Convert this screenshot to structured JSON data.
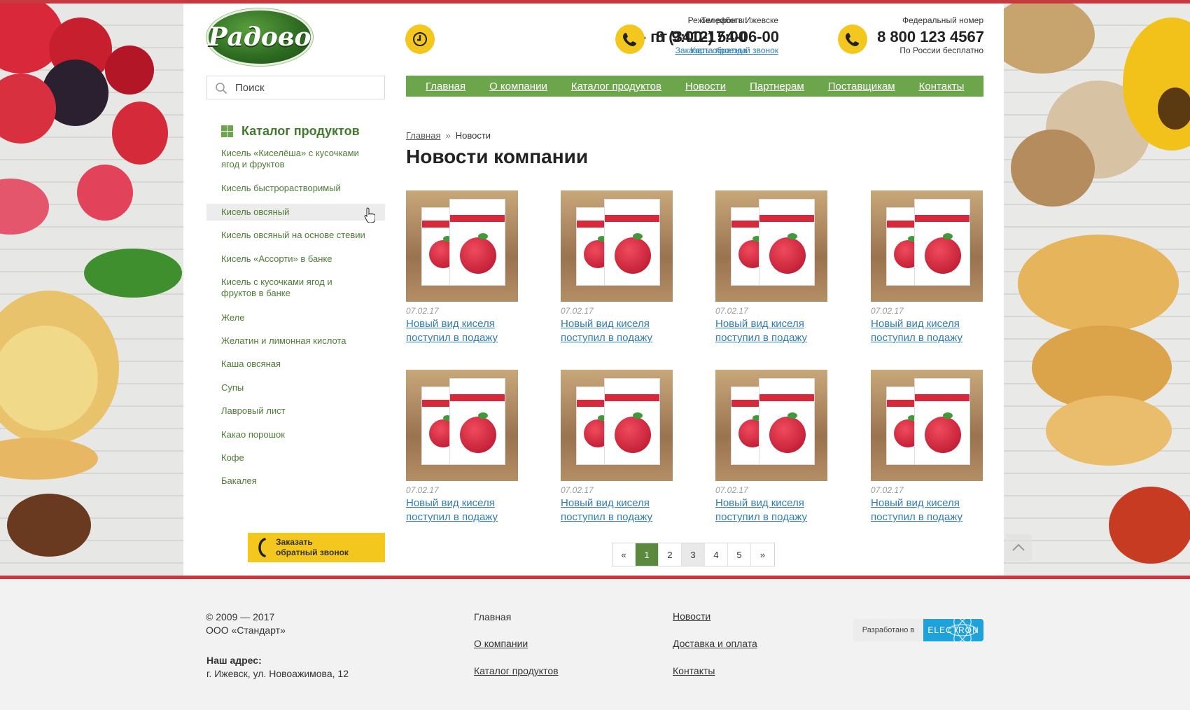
{
  "colors": {
    "accent_red": "#c9373f",
    "nav_green": "#6ca54b",
    "link_blue": "#2e7db6",
    "yellow": "#f4c71e"
  },
  "header": {
    "logo_text": "Радово",
    "hours": {
      "label": "Режим работы:",
      "value": "пн- пт 9:00-17:00",
      "link": "Карта проезда",
      "icon": "clock-icon"
    },
    "phone_local": {
      "label": "Телефон в Ижевске",
      "value": "8 (3412) 54-06-00",
      "link": "Заказать обратный звонок",
      "icon": "phone-icon"
    },
    "phone_federal": {
      "label": "Федеральный номер",
      "value": "8 800 123 4567",
      "sub": "По России бесплатно",
      "icon": "phone-icon"
    }
  },
  "search": {
    "placeholder": "Поиск"
  },
  "nav": [
    "Главная",
    "О компании",
    "Каталог продуктов",
    "Новости",
    "Партнерам",
    "Поставщикам",
    "Контакты"
  ],
  "sidebar": {
    "title": "Каталог продуктов",
    "items": [
      "Кисель «Киселёша» с кусочками ягод и фруктов",
      "Кисель быстрорастворимый",
      "Кисель овсяный",
      "Кисель овсяный на основе стевии",
      "Кисель «Ассорти» в банке",
      "Кисель с кусочками ягод и фруктов в банке",
      "Желе",
      "Желатин и лимонная кислота",
      "Каша овсяная",
      "Супы",
      "Лавровый лист",
      "Какао порошок",
      "Кофе",
      "Бакалея"
    ],
    "active_index": 2,
    "callback_line1": "Заказать",
    "callback_line2": "обратный звонок"
  },
  "breadcrumb": {
    "home": "Главная",
    "separator": "»",
    "current": "Новости"
  },
  "page_title": "Новости компании",
  "news": [
    {
      "date": "07.02.17",
      "title": "Новый вид киселя поступил в подажу"
    },
    {
      "date": "07.02.17",
      "title": "Новый вид киселя поступил в подажу"
    },
    {
      "date": "07.02.17",
      "title": "Новый вид киселя поступил в подажу"
    },
    {
      "date": "07.02.17",
      "title": "Новый вид киселя поступил в подажу"
    },
    {
      "date": "07.02.17",
      "title": "Новый вид киселя поступил в подажу"
    },
    {
      "date": "07.02.17",
      "title": "Новый вид киселя поступил в подажу"
    },
    {
      "date": "07.02.17",
      "title": "Новый вид киселя поступил в подажу"
    },
    {
      "date": "07.02.17",
      "title": "Новый вид киселя поступил в подажу"
    }
  ],
  "pagination": {
    "prev": "«",
    "pages": [
      "1",
      "2",
      "3",
      "4",
      "5"
    ],
    "next": "»",
    "current": "1"
  },
  "footer": {
    "copyright": "© 2009 — 2017",
    "company": "ООО «Стандарт»",
    "address_label": "Наш адрес:",
    "address": "г. Ижевск, ул. Новоажимова, 12",
    "col1": [
      "Главная",
      "О компании",
      "Каталог продуктов"
    ],
    "col2": [
      "Новости",
      "Доставка и оплата",
      "Контакты"
    ],
    "dev_label": "Разработано в",
    "dev_brand": "ELECTRON"
  }
}
